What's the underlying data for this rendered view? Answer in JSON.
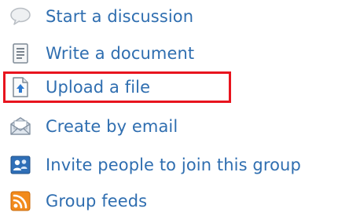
{
  "menu": {
    "items": [
      {
        "label": "Start a discussion",
        "icon": "speech-bubble-icon"
      },
      {
        "label": "Write a document",
        "icon": "document-icon"
      },
      {
        "label": "Upload a file",
        "icon": "upload-file-icon"
      },
      {
        "label": "Create by email",
        "icon": "email-icon"
      },
      {
        "label": "Invite people to join this group",
        "icon": "invite-people-icon"
      },
      {
        "label": "Group feeds",
        "icon": "rss-feed-icon"
      }
    ],
    "highlighted_item": "Upload a file"
  },
  "colors": {
    "link": "#2f6eb0",
    "highlight_border": "#e8141e"
  }
}
